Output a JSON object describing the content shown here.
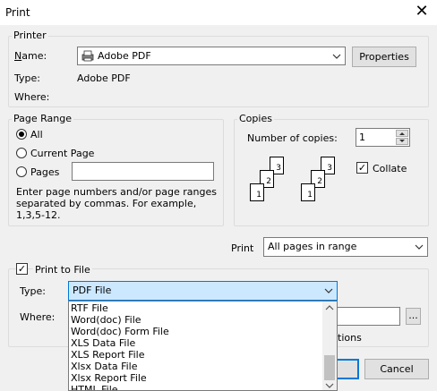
{
  "window": {
    "title": "Print"
  },
  "printer": {
    "group_label": "Printer",
    "name_label": "Name:",
    "name_value": "Adobe PDF",
    "properties_label": "Properties",
    "type_label": "Type:",
    "type_value": "Adobe PDF",
    "where_label": "Where:"
  },
  "page_range": {
    "group_label": "Page Range",
    "all_label": "All",
    "current_label": "Current Page",
    "pages_label": "Pages",
    "pages_value": "",
    "help_text_1": "Enter page numbers and/or page ranges",
    "help_text_2": "separated by commas.  For example,",
    "help_text_3": "1,3,5-12.",
    "selected": "All"
  },
  "copies": {
    "group_label": "Copies",
    "number_label": "Number of copies:",
    "number_value": "1",
    "collate_label": "Collate",
    "collate_checked": true,
    "stack_pages": [
      "1",
      "2",
      "3"
    ]
  },
  "print_what": {
    "label": "Print",
    "value": "All pages in range"
  },
  "print_to_file": {
    "label": "Print to File",
    "checked": true,
    "type_label": "Type:",
    "type_value": "PDF File",
    "where_label": "Where:",
    "where_value": "",
    "browse_label": "...",
    "options_partial": "tions"
  },
  "type_dropdown": {
    "items": [
      "RTF File",
      "Word(doc) File",
      "Word(doc) Form File",
      "XLS Data File",
      "XLS Report File",
      "Xlsx Data File",
      "Xlsx Report File",
      "HTML File"
    ]
  },
  "footer": {
    "cancel_label": "Cancel"
  },
  "colors": {
    "accent": "#0078d7",
    "selected_bg": "#cce8ff"
  }
}
